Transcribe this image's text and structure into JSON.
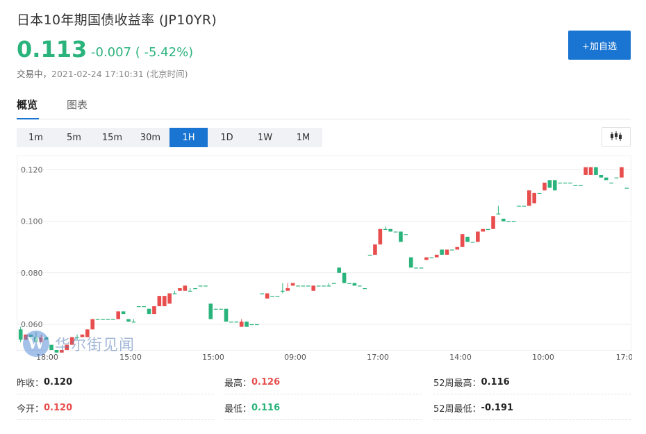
{
  "header": {
    "title": "日本10年期国债收益率 (JP10YR)",
    "price": "0.113",
    "change": "-0.007 ( -5.42%)",
    "status": "交易中，",
    "time": "2021-02-24 17:10:31 (北京时间)",
    "add_button": "+加自选"
  },
  "tabs": [
    "概览",
    "图表"
  ],
  "periods": [
    "1m",
    "5m",
    "15m",
    "30m",
    "1H",
    "1D",
    "1W",
    "1M"
  ],
  "active_period": "1H",
  "icons": {
    "chart_type": "candlestick-icon"
  },
  "watermark": {
    "logo": "W",
    "text": "华尔街见闻"
  },
  "colors": {
    "up": "#e84e4e",
    "down": "#2bb37c",
    "accent": "#1a74d1"
  },
  "chart_data": {
    "type": "candlestick",
    "ylim": [
      0.05,
      0.125
    ],
    "y_ticks": [
      "0.120",
      "0.100",
      "0.080",
      "0.060"
    ],
    "x_ticks": [
      "18:00",
      "15:00",
      "15:00",
      "09:00",
      "17:00",
      "14:00",
      "10:00",
      "17:0"
    ],
    "candles": [
      [
        0.058,
        0.054,
        0.059,
        0.053
      ],
      [
        0.054,
        0.056,
        0.056,
        0.054
      ],
      [
        0.056,
        0.055,
        0.056,
        0.054
      ],
      [
        0.055,
        0.053,
        0.057,
        0.053
      ],
      [
        0.053,
        0.055,
        0.056,
        0.053
      ],
      [
        0.055,
        0.054,
        0.055,
        0.054
      ],
      [
        0.052,
        0.05,
        0.052,
        0.05
      ],
      [
        0.05,
        0.049,
        0.05,
        0.049
      ],
      [
        0.049,
        0.05,
        0.05,
        0.049
      ],
      [
        0.05,
        0.052,
        0.052,
        0.05
      ],
      [
        0.052,
        0.055,
        0.055,
        0.052
      ],
      [
        0.055,
        0.055,
        0.056,
        0.054
      ],
      [
        0.055,
        0.056,
        0.056,
        0.055
      ],
      [
        0.055,
        0.058,
        0.058,
        0.055
      ],
      [
        0.058,
        0.062,
        0.062,
        0.058
      ],
      [
        0.062,
        0.062,
        0.062,
        0.062
      ],
      [
        0.062,
        0.062,
        0.062,
        0.062
      ],
      [
        0.062,
        0.062,
        0.062,
        0.062
      ],
      [
        0.062,
        0.062,
        0.062,
        0.062
      ],
      [
        0.062,
        0.065,
        0.065,
        0.062
      ],
      [
        0.065,
        0.064,
        0.065,
        0.064
      ],
      [
        0.062,
        0.061,
        0.062,
        0.061
      ],
      [
        0.061,
        0.061,
        0.062,
        0.061
      ],
      [
        0.067,
        0.067,
        0.067,
        0.067
      ],
      [
        0.067,
        0.067,
        0.067,
        0.067
      ],
      [
        0.066,
        0.064,
        0.066,
        0.064
      ],
      [
        0.064,
        0.067,
        0.067,
        0.064
      ],
      [
        0.067,
        0.071,
        0.071,
        0.067
      ],
      [
        0.067,
        0.071,
        0.071,
        0.067
      ],
      [
        0.068,
        0.072,
        0.072,
        0.068
      ],
      [
        0.072,
        0.072,
        0.073,
        0.072
      ],
      [
        0.073,
        0.074,
        0.074,
        0.073
      ],
      [
        0.073,
        0.075,
        0.075,
        0.073
      ],
      [
        0.073,
        0.073,
        0.074,
        0.073
      ],
      [
        0.074,
        0.074,
        0.074,
        0.074
      ],
      [
        0.075,
        0.075,
        0.075,
        0.075
      ],
      [
        0.075,
        0.075,
        0.075,
        0.075
      ],
      [
        0.068,
        0.062,
        0.068,
        0.062
      ],
      [
        0.066,
        0.066,
        0.066,
        0.066
      ],
      [
        0.066,
        0.066,
        0.066,
        0.066
      ],
      [
        0.066,
        0.061,
        0.066,
        0.061
      ],
      [
        0.061,
        0.061,
        0.061,
        0.061
      ],
      [
        0.061,
        0.061,
        0.061,
        0.061
      ],
      [
        0.059,
        0.061,
        0.062,
        0.059
      ],
      [
        0.061,
        0.059,
        0.061,
        0.059
      ],
      [
        0.06,
        0.06,
        0.06,
        0.06
      ],
      [
        0.06,
        0.06,
        0.06,
        0.06
      ],
      [
        0.072,
        0.072,
        0.072,
        0.072
      ],
      [
        0.07,
        0.072,
        0.072,
        0.07
      ],
      [
        0.071,
        0.071,
        0.071,
        0.071
      ],
      [
        0.071,
        0.071,
        0.071,
        0.071
      ],
      [
        0.073,
        0.073,
        0.076,
        0.072
      ],
      [
        0.073,
        0.074,
        0.076,
        0.073
      ],
      [
        0.075,
        0.076,
        0.076,
        0.075
      ],
      [
        0.075,
        0.075,
        0.075,
        0.075
      ],
      [
        0.075,
        0.075,
        0.075,
        0.075
      ],
      [
        0.075,
        0.075,
        0.075,
        0.075
      ],
      [
        0.073,
        0.075,
        0.075,
        0.073
      ],
      [
        0.075,
        0.075,
        0.075,
        0.075
      ],
      [
        0.075,
        0.075,
        0.075,
        0.075
      ],
      [
        0.075,
        0.075,
        0.076,
        0.075
      ],
      [
        0.076,
        0.076,
        0.076,
        0.076
      ],
      [
        0.082,
        0.08,
        0.082,
        0.08
      ],
      [
        0.08,
        0.076,
        0.08,
        0.076
      ],
      [
        0.076,
        0.076,
        0.076,
        0.076
      ],
      [
        0.076,
        0.075,
        0.076,
        0.075
      ],
      [
        0.075,
        0.075,
        0.075,
        0.075
      ],
      [
        0.074,
        0.074,
        0.074,
        0.074
      ],
      [
        0.087,
        0.087,
        0.087,
        0.087
      ],
      [
        0.087,
        0.091,
        0.091,
        0.087
      ],
      [
        0.091,
        0.097,
        0.097,
        0.091
      ],
      [
        0.097,
        0.097,
        0.098,
        0.097
      ],
      [
        0.097,
        0.096,
        0.097,
        0.096
      ],
      [
        0.096,
        0.096,
        0.096,
        0.096
      ],
      [
        0.096,
        0.092,
        0.096,
        0.092
      ],
      [
        0.095,
        0.095,
        0.095,
        0.095
      ],
      [
        0.086,
        0.082,
        0.086,
        0.082
      ],
      [
        0.082,
        0.082,
        0.082,
        0.082
      ],
      [
        0.082,
        0.082,
        0.082,
        0.082
      ],
      [
        0.085,
        0.086,
        0.086,
        0.085
      ],
      [
        0.086,
        0.086,
        0.086,
        0.086
      ],
      [
        0.086,
        0.087,
        0.087,
        0.086
      ],
      [
        0.089,
        0.087,
        0.089,
        0.087
      ],
      [
        0.087,
        0.089,
        0.089,
        0.087
      ],
      [
        0.089,
        0.089,
        0.089,
        0.089
      ],
      [
        0.089,
        0.09,
        0.09,
        0.089
      ],
      [
        0.09,
        0.095,
        0.095,
        0.09
      ],
      [
        0.094,
        0.092,
        0.094,
        0.092
      ],
      [
        0.092,
        0.092,
        0.092,
        0.092
      ],
      [
        0.092,
        0.096,
        0.096,
        0.092
      ],
      [
        0.096,
        0.097,
        0.097,
        0.096
      ],
      [
        0.097,
        0.097,
        0.097,
        0.097
      ],
      [
        0.097,
        0.102,
        0.102,
        0.097
      ],
      [
        0.103,
        0.103,
        0.106,
        0.103
      ],
      [
        0.101,
        0.1,
        0.101,
        0.1
      ],
      [
        0.1,
        0.1,
        0.1,
        0.1
      ],
      [
        0.1,
        0.1,
        0.1,
        0.1
      ],
      [
        0.106,
        0.106,
        0.106,
        0.106
      ],
      [
        0.106,
        0.106,
        0.106,
        0.106
      ],
      [
        0.106,
        0.112,
        0.112,
        0.106
      ],
      [
        0.107,
        0.111,
        0.111,
        0.107
      ],
      [
        0.111,
        0.111,
        0.111,
        0.111
      ],
      [
        0.112,
        0.115,
        0.115,
        0.112
      ],
      [
        0.116,
        0.113,
        0.116,
        0.113
      ],
      [
        0.116,
        0.112,
        0.116,
        0.112
      ],
      [
        0.115,
        0.115,
        0.115,
        0.115
      ],
      [
        0.115,
        0.115,
        0.115,
        0.115
      ],
      [
        0.115,
        0.115,
        0.115,
        0.115
      ],
      [
        0.114,
        0.114,
        0.114,
        0.114
      ],
      [
        0.114,
        0.114,
        0.114,
        0.114
      ],
      [
        0.118,
        0.121,
        0.121,
        0.118
      ],
      [
        0.118,
        0.121,
        0.121,
        0.118
      ],
      [
        0.121,
        0.118,
        0.121,
        0.118
      ],
      [
        0.118,
        0.117,
        0.118,
        0.117
      ],
      [
        0.117,
        0.116,
        0.117,
        0.116
      ],
      [
        0.115,
        0.115,
        0.115,
        0.115
      ],
      [
        0.117,
        0.117,
        0.117,
        0.117
      ],
      [
        0.117,
        0.121,
        0.121,
        0.117
      ],
      [
        0.113,
        0.113,
        0.113,
        0.113
      ]
    ]
  },
  "stats": [
    {
      "label": "昨收：",
      "value": "0.120",
      "color": "dark"
    },
    {
      "label": "最高：",
      "value": "0.126",
      "color": "red"
    },
    {
      "label": "52周最高：",
      "value": "0.116",
      "color": "dark"
    },
    {
      "label": "今开：",
      "value": "0.120",
      "color": "red"
    },
    {
      "label": "最低：",
      "value": "0.116",
      "color": "green"
    },
    {
      "label": "52周最低：",
      "value": "-0.191",
      "color": "dark"
    }
  ]
}
